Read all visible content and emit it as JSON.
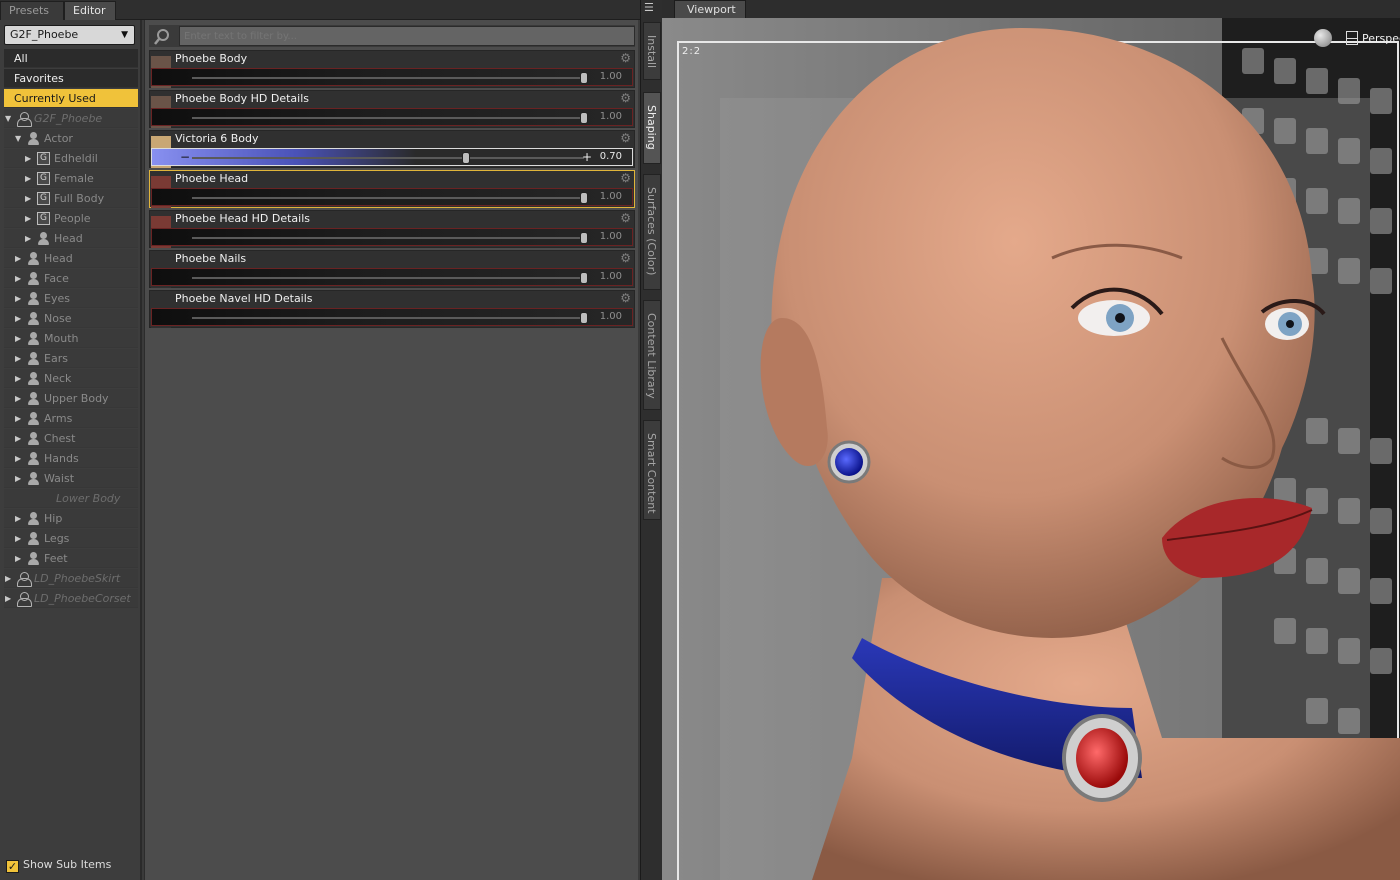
{
  "left_pane": {
    "tabs": [
      {
        "label": "Presets"
      },
      {
        "label": "Editor"
      }
    ],
    "figure_select": "G2F_Phoebe",
    "categories": [
      {
        "label": "All"
      },
      {
        "label": "Favorites"
      },
      {
        "label": "Currently Used",
        "selected": true
      }
    ],
    "tree": [
      {
        "label": "G2F_Phoebe",
        "indent": 0,
        "icon": "figure-icon",
        "twisty": "▼",
        "italic": true
      },
      {
        "label": "Actor",
        "indent": 1,
        "icon": "person-icon",
        "twisty": "▼"
      },
      {
        "label": "Edheldil",
        "indent": 2,
        "icon": "group-icon",
        "twisty": "▶"
      },
      {
        "label": "Female",
        "indent": 2,
        "icon": "group-icon",
        "twisty": "▶"
      },
      {
        "label": "Full Body",
        "indent": 2,
        "icon": "group-icon",
        "twisty": "▶"
      },
      {
        "label": "People",
        "indent": 2,
        "icon": "group-icon",
        "twisty": "▶"
      },
      {
        "label": "Head",
        "indent": 2,
        "icon": "person-icon",
        "twisty": "▶"
      },
      {
        "label": "Head",
        "indent": 1,
        "icon": "person-icon",
        "twisty": "▶"
      },
      {
        "label": "Face",
        "indent": 1,
        "icon": "person-icon",
        "twisty": "▶"
      },
      {
        "label": "Eyes",
        "indent": 1,
        "icon": "person-icon",
        "twisty": "▶"
      },
      {
        "label": "Nose",
        "indent": 1,
        "icon": "person-icon",
        "twisty": "▶"
      },
      {
        "label": "Mouth",
        "indent": 1,
        "icon": "person-icon",
        "twisty": "▶"
      },
      {
        "label": "Ears",
        "indent": 1,
        "icon": "person-icon",
        "twisty": "▶"
      },
      {
        "label": "Neck",
        "indent": 1,
        "icon": "person-icon",
        "twisty": "▶"
      },
      {
        "label": "Upper Body",
        "indent": 1,
        "icon": "person-icon",
        "twisty": "▶"
      },
      {
        "label": "Arms",
        "indent": 1,
        "icon": "person-icon",
        "twisty": "▶"
      },
      {
        "label": "Chest",
        "indent": 1,
        "icon": "person-icon",
        "twisty": "▶"
      },
      {
        "label": "Hands",
        "indent": 1,
        "icon": "person-icon",
        "twisty": "▶"
      },
      {
        "label": "Waist",
        "indent": 1,
        "icon": "person-icon",
        "twisty": "▶"
      },
      {
        "label": "Lower Body",
        "indent": 1,
        "icon": "",
        "twisty": "",
        "italic": true
      },
      {
        "label": "Hip",
        "indent": 1,
        "icon": "person-icon",
        "twisty": "▶"
      },
      {
        "label": "Legs",
        "indent": 1,
        "icon": "person-icon",
        "twisty": "▶"
      },
      {
        "label": "Feet",
        "indent": 1,
        "icon": "person-icon",
        "twisty": "▶"
      },
      {
        "label": "LD_PhoebeSkirt",
        "indent": 0,
        "icon": "figure-icon",
        "twisty": "▶",
        "italic": true
      },
      {
        "label": "LD_PhoebeCorset",
        "indent": 0,
        "icon": "figure-icon",
        "twisty": "▶",
        "italic": true
      }
    ],
    "show_sub_items": "Show Sub Items",
    "filter_placeholder": "Enter text to filter by...",
    "sliders": [
      {
        "label": "Phoebe Body",
        "value": "1.00",
        "level": 1.0,
        "thumb": "body"
      },
      {
        "label": "Phoebe Body HD Details",
        "value": "1.00",
        "level": 1.0,
        "thumb": "body"
      },
      {
        "label": "Victoria 6 Body",
        "value": "0.70",
        "level": 0.7,
        "thumb": "blonde",
        "special": true
      },
      {
        "label": "Phoebe Head",
        "value": "1.00",
        "level": 1.0,
        "thumb": "head",
        "highlight": true
      },
      {
        "label": "Phoebe Head HD Details",
        "value": "1.00",
        "level": 1.0,
        "thumb": "head"
      },
      {
        "label": "Phoebe Nails",
        "value": "1.00",
        "level": 1.0,
        "thumb": ""
      },
      {
        "label": "Phoebe Navel HD Details",
        "value": "1.00",
        "level": 1.0,
        "thumb": ""
      }
    ],
    "minus_glyph": "−",
    "plus_glyph": "+"
  },
  "side_tabs": [
    {
      "label": "Install"
    },
    {
      "label": "Shaping",
      "active": true
    },
    {
      "label": "Surfaces (Color)"
    },
    {
      "label": "Content Library"
    },
    {
      "label": "Smart Content"
    }
  ],
  "viewport": {
    "tab": "Viewport",
    "ratio": "2:2",
    "camera": "Perspec"
  },
  "colors": {
    "accent": "#f0c23a",
    "skin": "#c98f73",
    "choker": "#1f2a8c",
    "gem": "#d21a1a"
  }
}
